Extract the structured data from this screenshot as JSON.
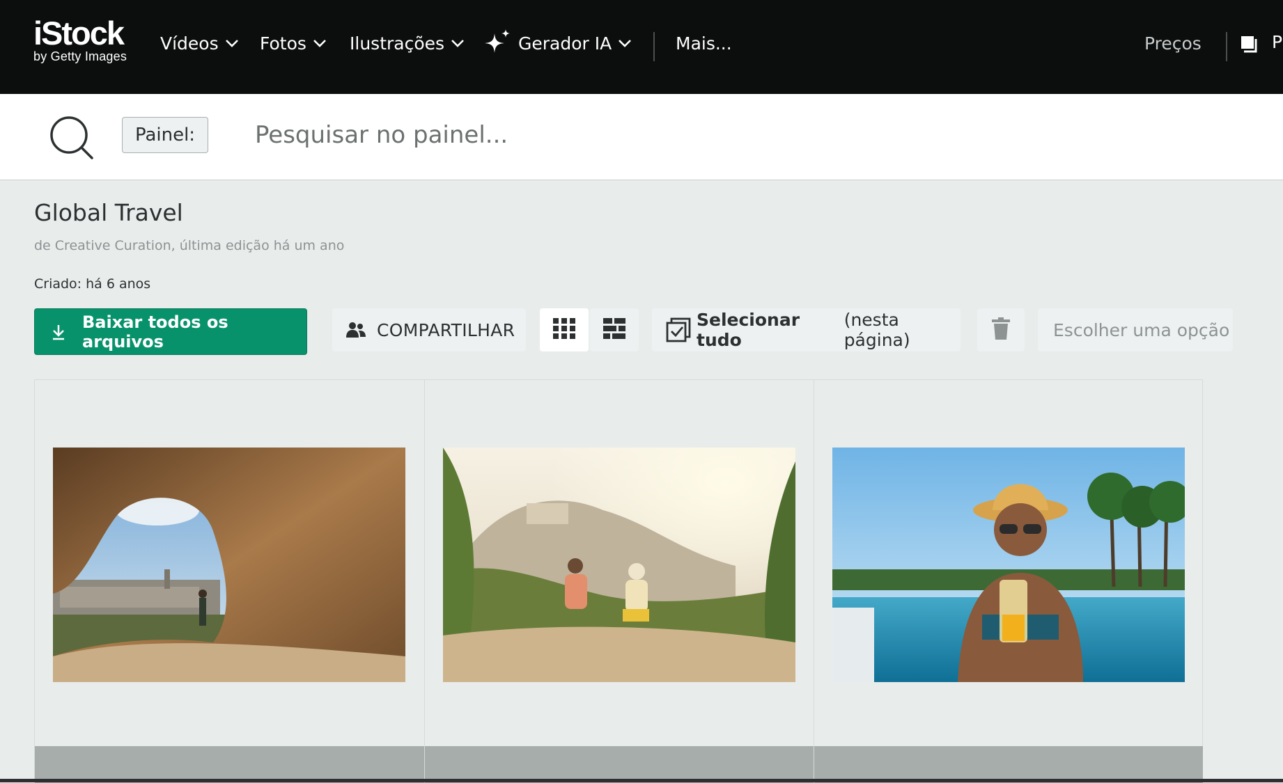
{
  "nav": {
    "logo_main": "iStock",
    "logo_sub": "by Getty Images",
    "items": [
      {
        "label": "Vídeos"
      },
      {
        "label": "Fotos"
      },
      {
        "label": "Ilustrações"
      },
      {
        "label": "Gerador IA"
      }
    ],
    "more_label": "Mais...",
    "pricing_label": "Preços",
    "cut_label": "P"
  },
  "search": {
    "scope_label": "Painel:",
    "placeholder": "Pesquisar no painel..."
  },
  "board": {
    "title": "Global Travel",
    "subtitle": "de Creative Curation, última edição há um ano",
    "created": "Criado: há 6 anos"
  },
  "toolbar": {
    "download_label": "Baixar todos os arquivos",
    "share_label": "COMPARTILHAR",
    "select_all_bold": "Selecionar tudo",
    "select_all_rest": "(nesta página)",
    "option_placeholder": "Escolher uma opção"
  },
  "icons": {
    "search": "search-icon",
    "download": "download-icon",
    "share": "users-icon",
    "grid": "grid-icon",
    "list": "list-icon",
    "select": "checkbox-icon",
    "trash": "trash-icon",
    "cart": "cart-icon",
    "sparkle": "sparkle-icon",
    "chevron": "chevron-down-icon"
  },
  "colors": {
    "topbar": "#0c0d0d",
    "accent": "#08926c",
    "background": "#e8eceb"
  },
  "images": [
    {
      "depicts": "cave-overlooking-town"
    },
    {
      "depicts": "couple-on-hillside-village"
    },
    {
      "depicts": "woman-in-pool-with-drink"
    }
  ]
}
